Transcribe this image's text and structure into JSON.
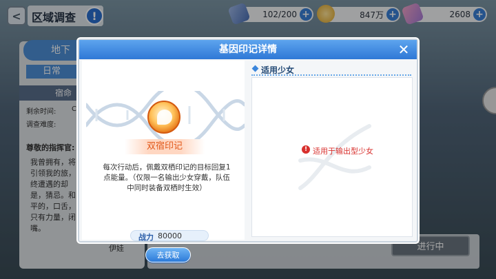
{
  "topbar": {
    "title": "区域调查",
    "help": "!",
    "back": "<",
    "resources": [
      {
        "icon": "energy-crystal-icon",
        "value": "102/200"
      },
      {
        "icon": "gold-coin-icon",
        "value": "847万"
      },
      {
        "icon": "gem-icon",
        "value": "2608"
      }
    ],
    "plus": "+"
  },
  "background": {
    "tab_top": "地下",
    "tab_daily": "日常",
    "header": "宿命",
    "row_remaining": "剩余时间:",
    "row_remaining_value": "C",
    "row_difficulty": "调查难度:",
    "greeting": "尊敬的指挥官:",
    "body": "我曾拥有，将引领我的旅，终遭遇的却是，猜忌。和平的，口舌，只有力量，闭嘴。",
    "signature": "伊娃",
    "progress_button": "进行中"
  },
  "dialog": {
    "title": "基因印记详情",
    "close": "✕",
    "emblem_name": "双宿印记",
    "description": "每次行动后，佩戴双栖印记的目标回复1点能量。（仅限一名输出少女穿戴，队伍中同时装备双栖时生效）",
    "power_label": "战力",
    "power_value": "80000",
    "get_button": "去获取",
    "applicable_label": "适用少女",
    "warning_icon": "!",
    "warning_text": "适用于输出型少女"
  },
  "colors": {
    "header_blue": "#2f78d6",
    "accent_orange": "#e25a1c",
    "warning_red": "#d8302d"
  }
}
